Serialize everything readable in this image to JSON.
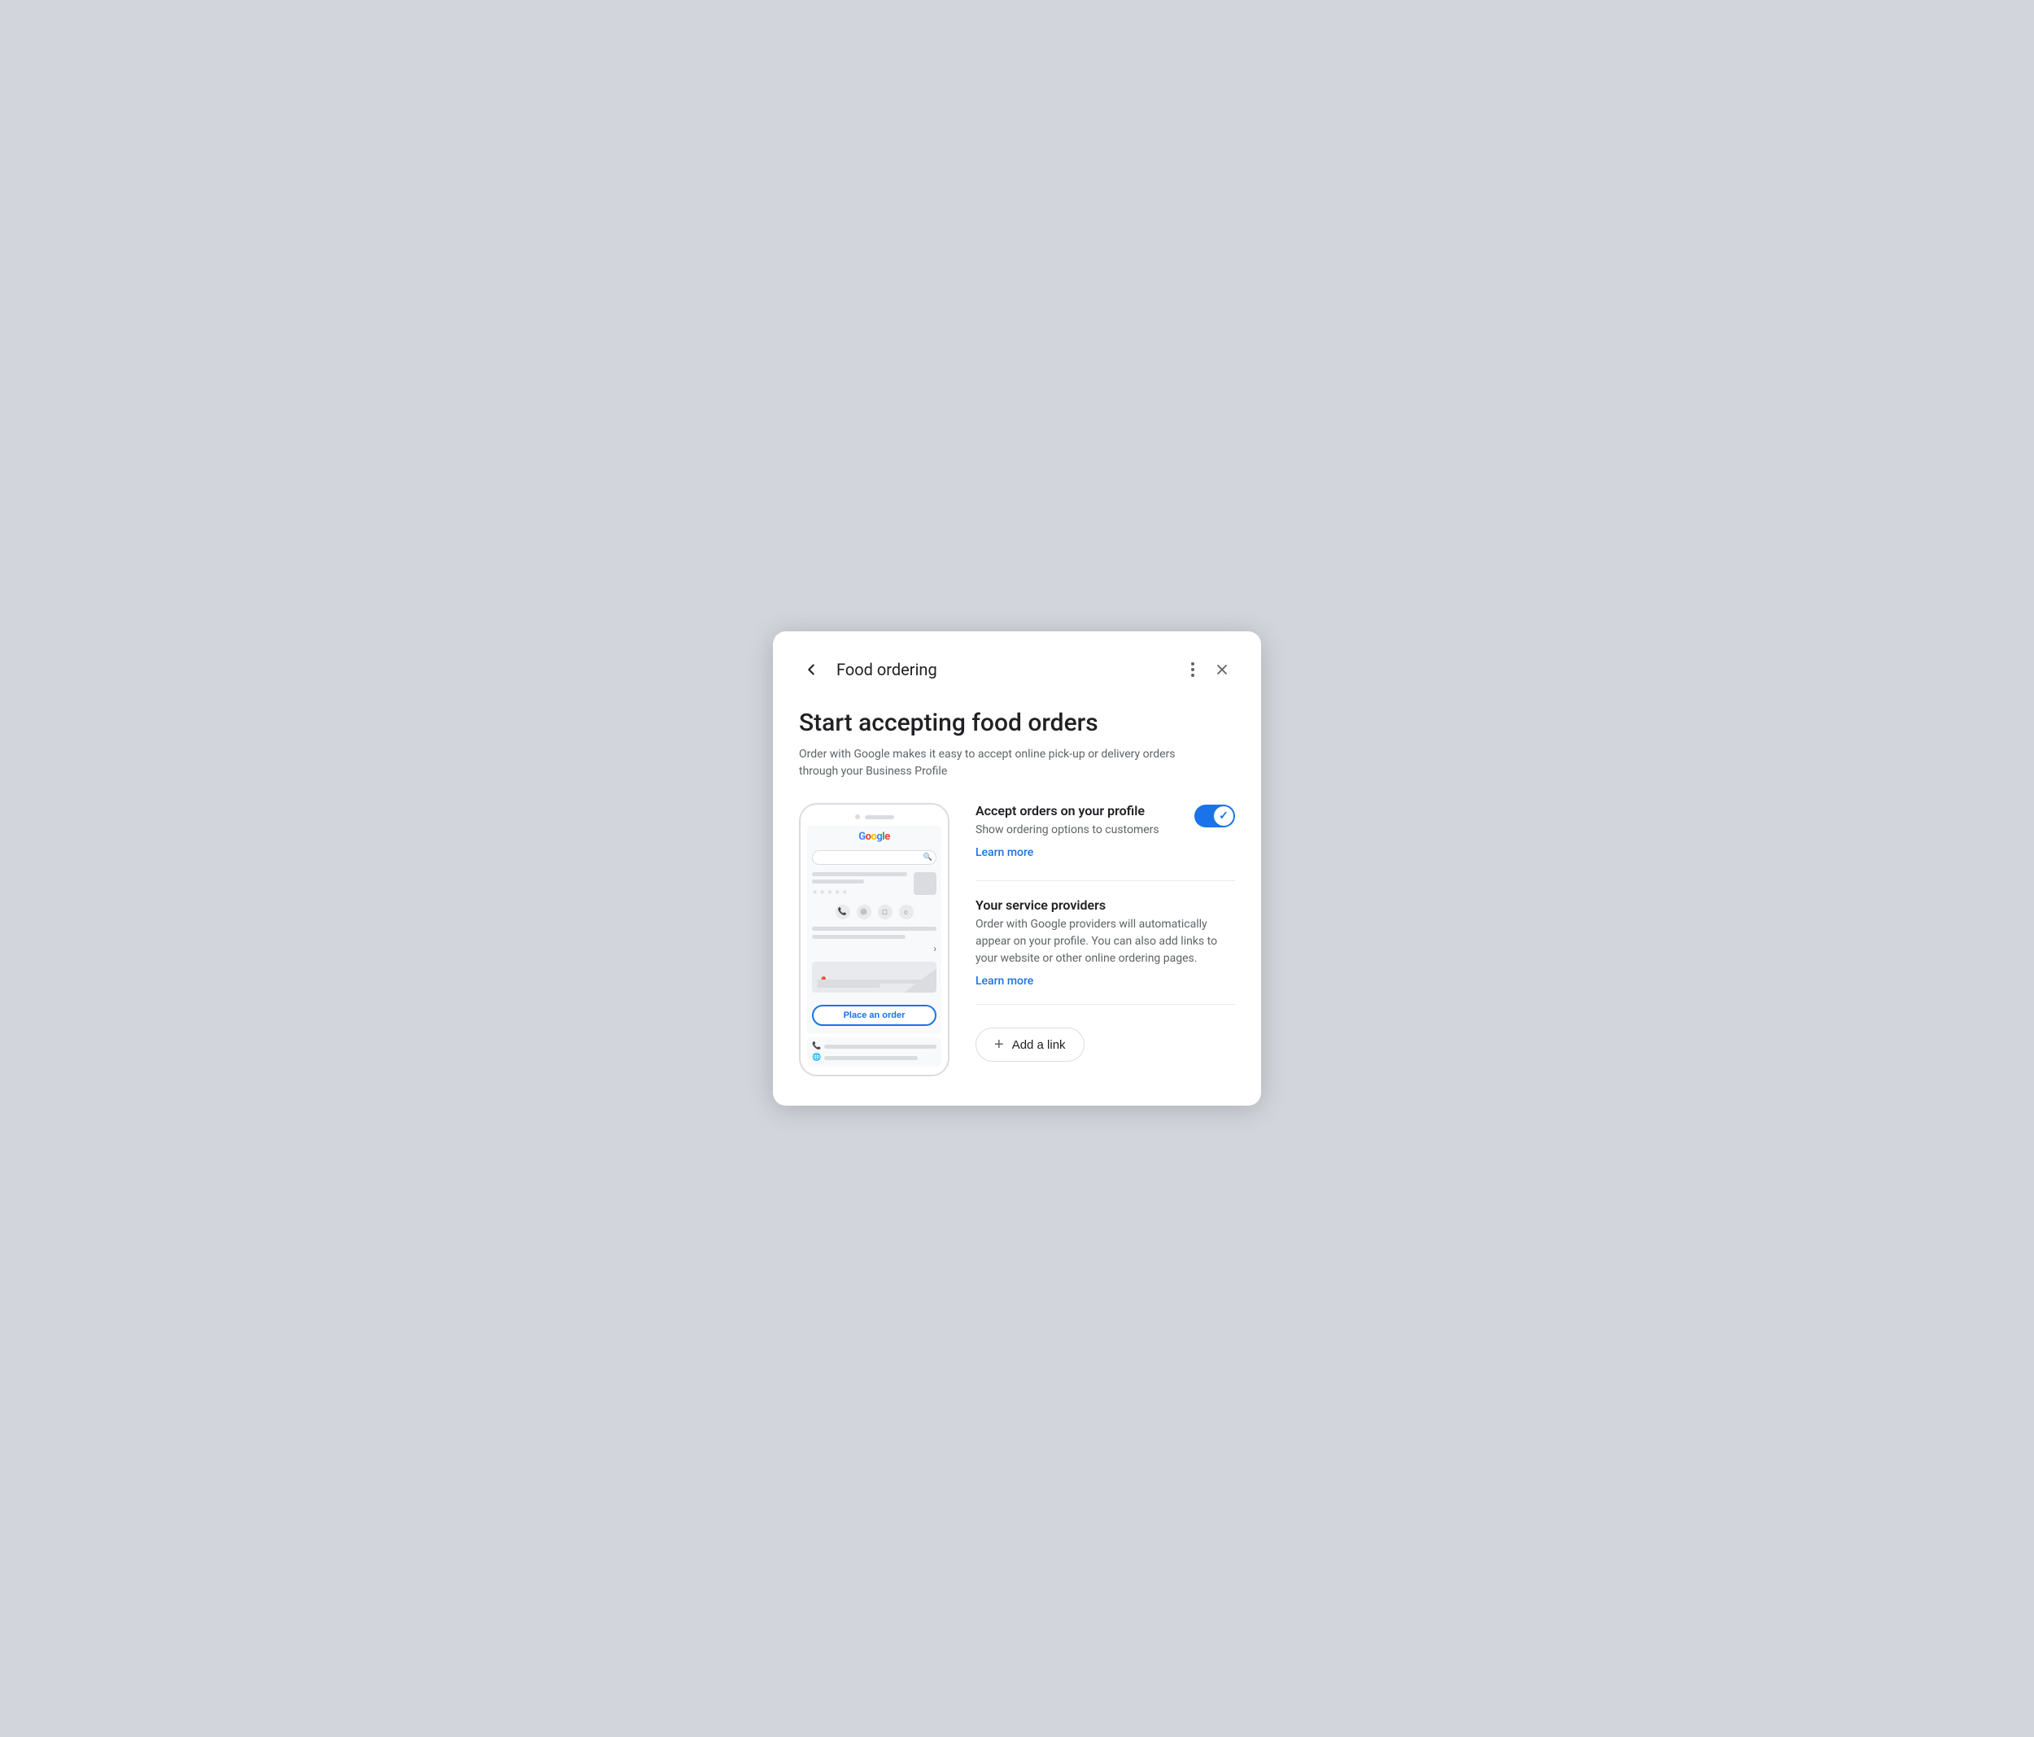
{
  "header": {
    "back_label": "←",
    "title": "Food ordering",
    "more_icon": "more-vert-icon",
    "close_icon": "close-icon"
  },
  "hero": {
    "title": "Start accepting food orders",
    "subtitle": "Order with Google makes it easy to accept online pick-up or delivery orders through your Business Profile"
  },
  "phone": {
    "google_logo": "Google",
    "place_order_label": "Place an order"
  },
  "sections": {
    "accept_orders": {
      "title": "Accept orders on your profile",
      "description": "Show ordering options to customers",
      "learn_more": "Learn more",
      "toggle_enabled": true
    },
    "service_providers": {
      "title": "Your service providers",
      "description": "Order with Google providers will automatically appear on your profile. You can also add links to your website or other online ordering pages.",
      "learn_more": "Learn more"
    }
  },
  "add_link_button": {
    "plus": "+",
    "label": "Add a link"
  }
}
